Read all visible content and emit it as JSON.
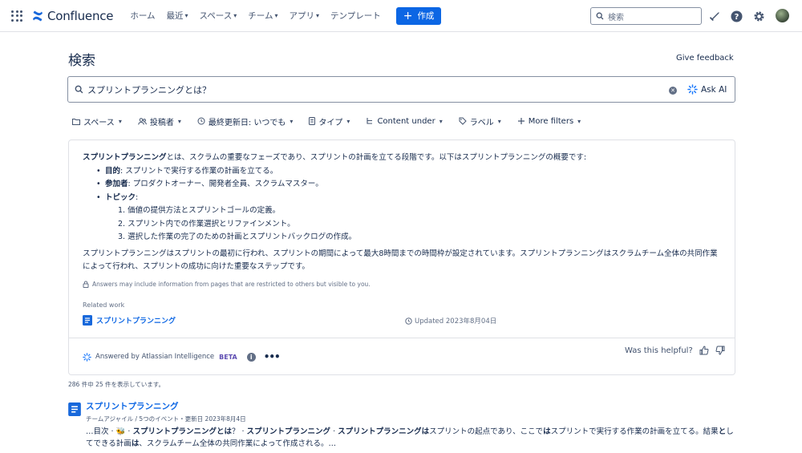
{
  "app": {
    "name": "Confluence"
  },
  "nav": {
    "items": [
      {
        "label": "ホーム",
        "dropdown": false
      },
      {
        "label": "最近",
        "dropdown": true
      },
      {
        "label": "スペース",
        "dropdown": true
      },
      {
        "label": "チーム",
        "dropdown": true
      },
      {
        "label": "アプリ",
        "dropdown": true
      },
      {
        "label": "テンプレート",
        "dropdown": false
      }
    ],
    "create_label": "作成",
    "search_placeholder": "検索"
  },
  "page": {
    "title": "検索",
    "feedback_label": "Give feedback"
  },
  "search": {
    "query": "スプリントプランニングとは？",
    "ask_ai_label": "Ask AI"
  },
  "filters": [
    {
      "label": "スペース",
      "icon": "folder-icon"
    },
    {
      "label": "投稿者",
      "icon": "people-icon"
    },
    {
      "label": "最終更新日: いつでも",
      "icon": "clock-icon"
    },
    {
      "label": "タイプ",
      "icon": "document-icon"
    },
    {
      "label": "Content under",
      "icon": "hierarchy-icon"
    },
    {
      "label": "ラベル",
      "icon": "tag-icon"
    },
    {
      "label": "More filters",
      "icon": "plus-icon"
    }
  ],
  "answer": {
    "intro_bold": "スプリントプランニング",
    "intro_rest": "とは、スクラムの重要なフェーズであり、スプリントの計画を立てる段階です。以下はスプリントプランニングの概要です:",
    "bullets": [
      {
        "bold": "目的",
        "text": ": スプリントで実行する作業の計画を立てる。"
      },
      {
        "bold": "参加者",
        "text": ": プロダクトオーナー、開発者全員、スクラムマスター。"
      },
      {
        "bold": "トピック",
        "text": ":"
      }
    ],
    "topics": [
      "1. 価値の提供方法とスプリントゴールの定義。",
      "2. スプリント内での作業選択とリファインメント。",
      "3. 選択した作業の完了のための計画とスプリントバックログの作成。"
    ],
    "paragraph2": "スプリントプランニングはスプリントの最初に行われ、スプリントの期間によって最大8時間までの時間枠が設定されています。スプリントプランニングはスクラムチーム全体の共同作業によって行われ、スプリントの成功に向けた重要なステップです。",
    "disclaimer": "Answers may include information from pages that are restricted to others but visible to you.",
    "related_heading": "Related work",
    "related_title": "スプリントプランニング",
    "related_updated": "Updated 2023年8月04日",
    "answered_by": "Answered by Atlassian Intelligence",
    "beta": "BETA",
    "helpful_label": "Was this helpful?"
  },
  "results": {
    "count_text": "286 件中 25 件を表示しています。",
    "items": [
      {
        "title": "スプリントプランニング",
        "meta": "チームアジャイル / 5つのイベント・更新日 2023年8月4日",
        "snippet_parts": [
          {
            "b": false,
            "t": "…目次 · 🐝 · "
          },
          {
            "b": true,
            "t": "スプリントプランニングとは"
          },
          {
            "b": false,
            "t": "？ · "
          },
          {
            "b": true,
            "t": "スプリントプランニング"
          },
          {
            "b": false,
            "t": " · "
          },
          {
            "b": true,
            "t": "スプリントプランニングは"
          },
          {
            "b": false,
            "t": "スプリントの起点であり、ここで"
          },
          {
            "b": true,
            "t": "は"
          },
          {
            "b": false,
            "t": "スプリントで実行する作業の計画を立てる。結果"
          },
          {
            "b": true,
            "t": "と"
          },
          {
            "b": false,
            "t": "してできる計画"
          },
          {
            "b": true,
            "t": "は"
          },
          {
            "b": false,
            "t": "、スクラムチーム全体の共同作業によって作成される。…"
          }
        ]
      }
    ]
  },
  "colors": {
    "brand": "#0c66e4",
    "text": "#172b4d",
    "subtle": "#626f86",
    "ai": "#5e4db2"
  }
}
